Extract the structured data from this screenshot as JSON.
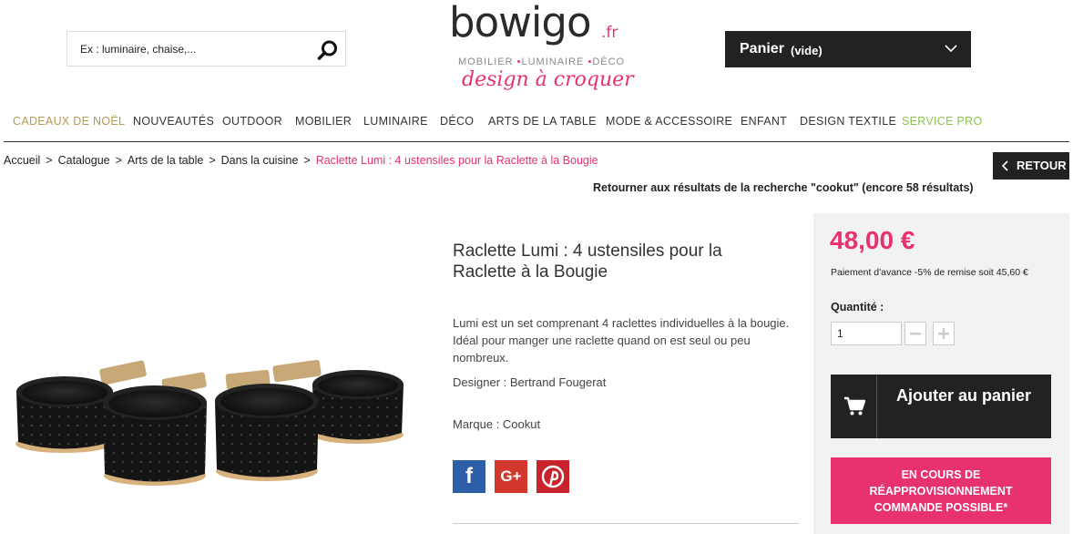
{
  "header": {
    "search": {
      "placeholder": "Ex : luminaire, chaise,...",
      "value": ""
    },
    "logo": {
      "word": "bowigo",
      "tld": ".fr",
      "subtitle_parts": [
        "MOBILIER",
        "•",
        "LUMINAIRE",
        "•",
        "DÉCO"
      ],
      "tagline": "design à croquer"
    },
    "cart": {
      "label": "Panier",
      "state": "(vide)"
    }
  },
  "nav": {
    "items": [
      {
        "label": "CADEAUX DE NOËL",
        "color": "#b59a52"
      },
      {
        "label": "NOUVEAUTÉS",
        "color": "#333333"
      },
      {
        "label": "OUTDOOR",
        "color": "#333333"
      },
      {
        "label": "MOBILIER",
        "color": "#333333"
      },
      {
        "label": "LUMINAIRE",
        "color": "#333333"
      },
      {
        "label": "DÉCO",
        "color": "#333333"
      },
      {
        "label": "ARTS DE LA TABLE",
        "color": "#333333"
      },
      {
        "label": "MODE & ACCESSOIRE",
        "color": "#333333"
      },
      {
        "label": "ENFANT",
        "color": "#333333"
      },
      {
        "label": "DESIGN TEXTILE",
        "color": "#333333"
      },
      {
        "label": "SERVICE PRO",
        "color": "#8cc152"
      }
    ]
  },
  "breadcrumb": {
    "items": [
      "Accueil",
      "Catalogue",
      "Arts de la table",
      "Dans la cuisine"
    ],
    "separator": ">",
    "current": "Raclette Lumi : 4 ustensiles pour la Raclette à la Bougie"
  },
  "back_button": {
    "label": "RETOUR"
  },
  "search_return": "Retourner aux résultats de la recherche \"cookut\" (encore 58 résultats)",
  "product": {
    "title": "Raclette Lumi : 4 ustensiles pour la Raclette à la Bougie",
    "description": "Lumi est un set comprenant 4 raclettes individuelles à la bougie. Idéal pour manger une raclette quand on est seul ou peu nombreux.",
    "designer": "Designer : Bertrand Fougerat",
    "brand": "Marque : Cookut",
    "share": {
      "facebook_glyph": "f",
      "googleplus_glyph": "G+",
      "pinterest_glyph": "P"
    }
  },
  "buybox": {
    "price": "48,00 €",
    "advance_payment": "Paiement d'avance -5% de remise soit 45,60 €",
    "quantity_label": "Quantité :",
    "quantity_value": "1",
    "add_to_cart": "Ajouter au panier",
    "restock": [
      "EN COURS DE",
      "RÉAPPROVISIONNEMENT",
      "COMMANDE POSSIBLE*"
    ]
  },
  "colors": {
    "accent": "#e8316f",
    "dark": "#222222",
    "panel": "#f2f2f2"
  },
  "icons": {
    "search": "search-icon",
    "cart_chevron": "chevron-down-icon",
    "back": "chevron-left-icon",
    "minus": "minus-icon",
    "plus": "plus-icon",
    "cart": "shopping-cart-icon"
  }
}
